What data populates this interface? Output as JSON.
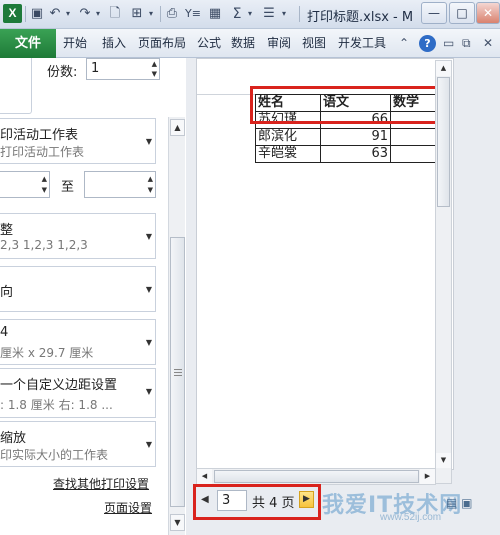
{
  "titlebar": {
    "app_logo": "X",
    "title": "打印标题.xlsx - M",
    "qat_icons": [
      "save-icon",
      "undo-icon",
      "redo-icon",
      "print-preview-icon",
      "layout-icon",
      "text-icon",
      "grid-icon",
      "filter-icon",
      "sum-icon",
      "sort-icon",
      "dropdown-icon"
    ],
    "min_label": "—",
    "max_label": "□",
    "close_label": "✕"
  },
  "ribbon": {
    "file_tab": "文件",
    "tabs": [
      "开始",
      "插入",
      "页面布局",
      "公式",
      "数据",
      "审阅",
      "视图",
      "开发工具"
    ],
    "help": "?"
  },
  "left_panel": {
    "copies_label": "份数:",
    "copies_value": "1",
    "print_what": {
      "title": "印活动工作表",
      "subtitle": "打印活动工作表"
    },
    "pages_to_label": "至",
    "collate": {
      "title": "整",
      "subtitle": "2,3    1,2,3    1,2,3"
    },
    "orientation": {
      "title": "向"
    },
    "paper": {
      "title": "4",
      "subtitle": "厘米 x 29.7 厘米"
    },
    "margins": {
      "title": "一个自定义边距设置",
      "subtitle": ":  1.8 厘米    右:  1.8 ..."
    },
    "scaling": {
      "title": "缩放",
      "subtitle": "印实际大小的工作表"
    },
    "link_more": "查找其他打印设置",
    "link_setup": "页面设置"
  },
  "sheet": {
    "headers": [
      "姓名",
      "语文",
      "数学"
    ],
    "rows": [
      {
        "name": "苏幻瑾",
        "chinese": "66",
        "math": ""
      },
      {
        "name": "郎滨化",
        "chinese": "91",
        "math": ""
      },
      {
        "name": "辛皑裳",
        "chinese": "63",
        "math": ""
      }
    ]
  },
  "navigation": {
    "current_page": "3",
    "page_count_text": "共 4 页"
  },
  "watermark": {
    "text": "我爱IT技术网",
    "url": "www.52ij.com"
  },
  "colors": {
    "excel_green": "#1e7a37",
    "highlight_red": "#d9231d",
    "help_blue": "#2f6cc6"
  }
}
